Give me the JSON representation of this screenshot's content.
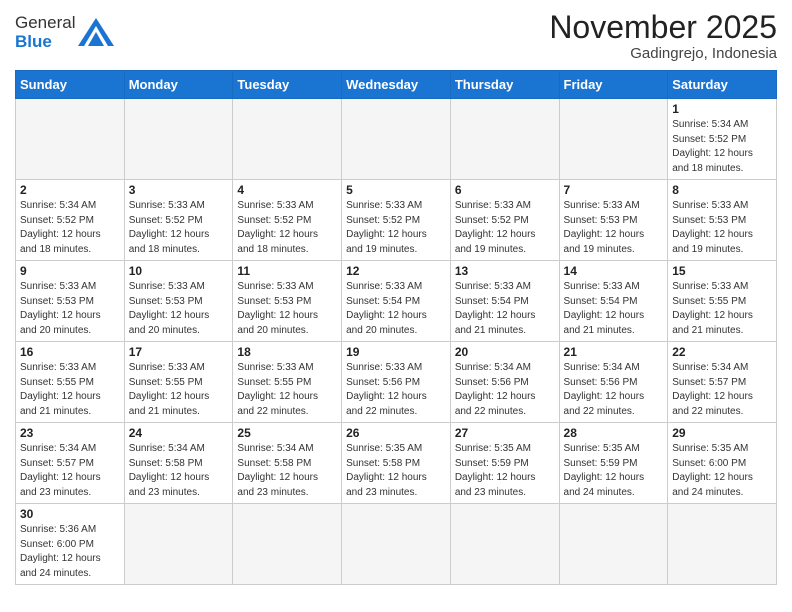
{
  "logo": {
    "text_general": "General",
    "text_blue": "Blue"
  },
  "header": {
    "month_title": "November 2025",
    "location": "Gadingrejo, Indonesia"
  },
  "weekdays": [
    "Sunday",
    "Monday",
    "Tuesday",
    "Wednesday",
    "Thursday",
    "Friday",
    "Saturday"
  ],
  "weeks": [
    [
      {
        "day": "",
        "empty": true,
        "info": ""
      },
      {
        "day": "",
        "empty": true,
        "info": ""
      },
      {
        "day": "",
        "empty": true,
        "info": ""
      },
      {
        "day": "",
        "empty": true,
        "info": ""
      },
      {
        "day": "",
        "empty": true,
        "info": ""
      },
      {
        "day": "",
        "empty": true,
        "info": ""
      },
      {
        "day": "1",
        "empty": false,
        "info": "Sunrise: 5:34 AM\nSunset: 5:52 PM\nDaylight: 12 hours and 18 minutes."
      }
    ],
    [
      {
        "day": "2",
        "info": "Sunrise: 5:34 AM\nSunset: 5:52 PM\nDaylight: 12 hours and 18 minutes."
      },
      {
        "day": "3",
        "info": "Sunrise: 5:33 AM\nSunset: 5:52 PM\nDaylight: 12 hours and 18 minutes."
      },
      {
        "day": "4",
        "info": "Sunrise: 5:33 AM\nSunset: 5:52 PM\nDaylight: 12 hours and 18 minutes."
      },
      {
        "day": "5",
        "info": "Sunrise: 5:33 AM\nSunset: 5:52 PM\nDaylight: 12 hours and 19 minutes."
      },
      {
        "day": "6",
        "info": "Sunrise: 5:33 AM\nSunset: 5:52 PM\nDaylight: 12 hours and 19 minutes."
      },
      {
        "day": "7",
        "info": "Sunrise: 5:33 AM\nSunset: 5:53 PM\nDaylight: 12 hours and 19 minutes."
      },
      {
        "day": "8",
        "info": "Sunrise: 5:33 AM\nSunset: 5:53 PM\nDaylight: 12 hours and 19 minutes."
      }
    ],
    [
      {
        "day": "9",
        "info": "Sunrise: 5:33 AM\nSunset: 5:53 PM\nDaylight: 12 hours and 20 minutes."
      },
      {
        "day": "10",
        "info": "Sunrise: 5:33 AM\nSunset: 5:53 PM\nDaylight: 12 hours and 20 minutes."
      },
      {
        "day": "11",
        "info": "Sunrise: 5:33 AM\nSunset: 5:53 PM\nDaylight: 12 hours and 20 minutes."
      },
      {
        "day": "12",
        "info": "Sunrise: 5:33 AM\nSunset: 5:54 PM\nDaylight: 12 hours and 20 minutes."
      },
      {
        "day": "13",
        "info": "Sunrise: 5:33 AM\nSunset: 5:54 PM\nDaylight: 12 hours and 21 minutes."
      },
      {
        "day": "14",
        "info": "Sunrise: 5:33 AM\nSunset: 5:54 PM\nDaylight: 12 hours and 21 minutes."
      },
      {
        "day": "15",
        "info": "Sunrise: 5:33 AM\nSunset: 5:55 PM\nDaylight: 12 hours and 21 minutes."
      }
    ],
    [
      {
        "day": "16",
        "info": "Sunrise: 5:33 AM\nSunset: 5:55 PM\nDaylight: 12 hours and 21 minutes."
      },
      {
        "day": "17",
        "info": "Sunrise: 5:33 AM\nSunset: 5:55 PM\nDaylight: 12 hours and 21 minutes."
      },
      {
        "day": "18",
        "info": "Sunrise: 5:33 AM\nSunset: 5:55 PM\nDaylight: 12 hours and 22 minutes."
      },
      {
        "day": "19",
        "info": "Sunrise: 5:33 AM\nSunset: 5:56 PM\nDaylight: 12 hours and 22 minutes."
      },
      {
        "day": "20",
        "info": "Sunrise: 5:34 AM\nSunset: 5:56 PM\nDaylight: 12 hours and 22 minutes."
      },
      {
        "day": "21",
        "info": "Sunrise: 5:34 AM\nSunset: 5:56 PM\nDaylight: 12 hours and 22 minutes."
      },
      {
        "day": "22",
        "info": "Sunrise: 5:34 AM\nSunset: 5:57 PM\nDaylight: 12 hours and 22 minutes."
      }
    ],
    [
      {
        "day": "23",
        "info": "Sunrise: 5:34 AM\nSunset: 5:57 PM\nDaylight: 12 hours and 23 minutes."
      },
      {
        "day": "24",
        "info": "Sunrise: 5:34 AM\nSunset: 5:58 PM\nDaylight: 12 hours and 23 minutes."
      },
      {
        "day": "25",
        "info": "Sunrise: 5:34 AM\nSunset: 5:58 PM\nDaylight: 12 hours and 23 minutes."
      },
      {
        "day": "26",
        "info": "Sunrise: 5:35 AM\nSunset: 5:58 PM\nDaylight: 12 hours and 23 minutes."
      },
      {
        "day": "27",
        "info": "Sunrise: 5:35 AM\nSunset: 5:59 PM\nDaylight: 12 hours and 23 minutes."
      },
      {
        "day": "28",
        "info": "Sunrise: 5:35 AM\nSunset: 5:59 PM\nDaylight: 12 hours and 24 minutes."
      },
      {
        "day": "29",
        "info": "Sunrise: 5:35 AM\nSunset: 6:00 PM\nDaylight: 12 hours and 24 minutes."
      }
    ],
    [
      {
        "day": "30",
        "info": "Sunrise: 5:36 AM\nSunset: 6:00 PM\nDaylight: 12 hours and 24 minutes."
      },
      {
        "day": "",
        "empty": true,
        "info": ""
      },
      {
        "day": "",
        "empty": true,
        "info": ""
      },
      {
        "day": "",
        "empty": true,
        "info": ""
      },
      {
        "day": "",
        "empty": true,
        "info": ""
      },
      {
        "day": "",
        "empty": true,
        "info": ""
      },
      {
        "day": "",
        "empty": true,
        "info": ""
      }
    ]
  ]
}
